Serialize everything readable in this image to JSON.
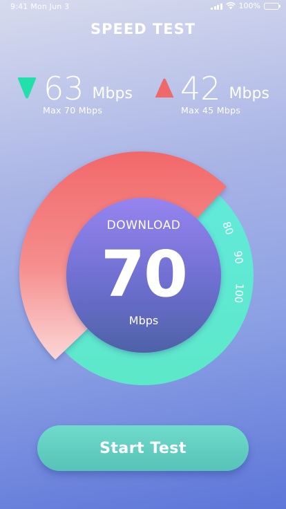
{
  "status_bar": {
    "time": "9:41 Mon Jun 3",
    "battery": "100%"
  },
  "title": "SPEED TEST",
  "download": {
    "value": "63",
    "unit": "Mbps",
    "max": "Max 70 Mbps",
    "icon": "download-arrow-icon",
    "color": "#22e0a9"
  },
  "upload": {
    "value": "42",
    "unit": "Mbps",
    "max": "Max 45 Mbps",
    "icon": "upload-arrow-icon",
    "color": "#ee6a6a"
  },
  "gauge": {
    "label": "DOWNLOAD",
    "value": "70",
    "unit": "Mbps",
    "ticks": [
      "80",
      "90",
      "100"
    ],
    "colors": {
      "red_arc": "#f2696b",
      "teal_arc": "#5fe8d0",
      "center_top": "#9684ef",
      "center_bottom": "#4e62a8"
    }
  },
  "start_button": {
    "label": "Start Test"
  }
}
